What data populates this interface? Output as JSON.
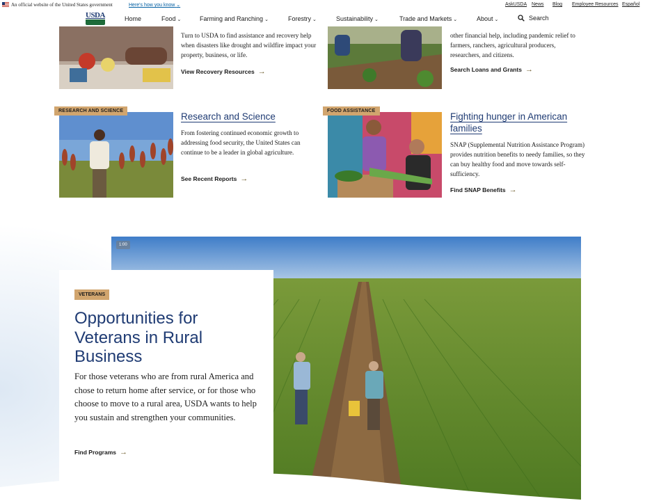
{
  "gov_banner": {
    "official_text": "An official website of the United States government",
    "how_link": "Here's how you know",
    "util_links": [
      "AskUSDA",
      "News",
      "Blog",
      "Employee Resources",
      "Español"
    ]
  },
  "nav": {
    "logo_text": "USDA",
    "items": [
      {
        "label": "Home",
        "dropdown": false
      },
      {
        "label": "Food",
        "dropdown": true
      },
      {
        "label": "Farming and Ranching",
        "dropdown": true
      },
      {
        "label": "Forestry",
        "dropdown": true
      },
      {
        "label": "Sustainability",
        "dropdown": true
      },
      {
        "label": "Trade and Markets",
        "dropdown": true
      },
      {
        "label": "About",
        "dropdown": true
      }
    ],
    "search_label": "Search"
  },
  "cards": {
    "recovery": {
      "text": "Turn to USDA to find assistance and recovery help when disasters like drought and wildfire impact your property, business, or life.",
      "link": "View Recovery Resources"
    },
    "loans": {
      "text_partial": "other financial help, including pandemic relief to farmers, ranchers, agricultural producers, researchers, and citizens.",
      "link": "Search Loans and Grants"
    },
    "research": {
      "tag": "RESEARCH AND SCIENCE",
      "title": "Research and Science",
      "text": "From fostering continued economic growth to addressing food security, the United States can continue to be a leader in global agriculture.",
      "link": "See Recent Reports"
    },
    "food": {
      "tag": "FOOD ASSISTANCE",
      "title": "Fighting hunger in American families",
      "text": "SNAP (Supplemental Nutrition Assistance Program) provides nutrition benefits to needy families, so they can buy healthy food and move towards self-sufficiency.",
      "link": "Find SNAP Benefits"
    }
  },
  "hero": {
    "duration": "1:00",
    "tag": "VETERANS",
    "title": "Opportunities for Veterans in Rural Business",
    "body": "For those veterans who are from rural America and chose to return home after service, or for those who choose to move to a rural area, USDA wants to help you sustain and strengthen your communities.",
    "link": "Find Programs"
  },
  "colors": {
    "brand_navy": "#1f3b73",
    "tag_tan": "#d1a56e",
    "arrow_olive": "#6b5a2a"
  }
}
